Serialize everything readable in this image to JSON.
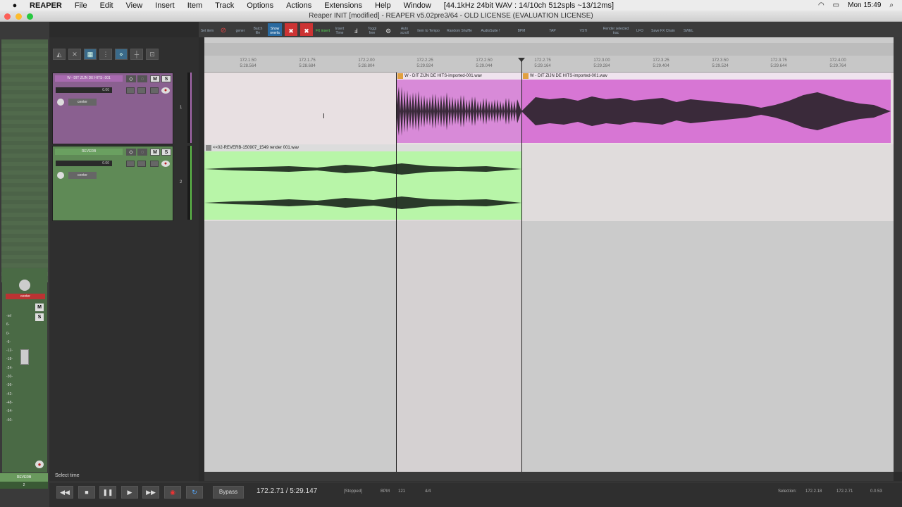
{
  "menubar": {
    "app": "REAPER",
    "items": [
      "File",
      "Edit",
      "View",
      "Insert",
      "Item",
      "Track",
      "Options",
      "Actions",
      "Extensions",
      "Help",
      "Window"
    ],
    "audio_info": "[44.1kHz 24bit WAV : 14/10ch 512spls ~13/12ms]",
    "clock": "Mon 15:49"
  },
  "window": {
    "title": "Reaper INIT [modified] - REAPER v5.02pre3/64 - OLD LICENSE (EVALUATION LICENSE)"
  },
  "toolbar": {
    "buttons": [
      "Set item",
      "",
      "gener",
      "Batch file",
      "Show overla",
      "",
      "",
      "FX insert",
      "Insert Time",
      "",
      "Toggl free",
      "",
      "Auto scroll",
      "Item to Tempo",
      "Random Shuffle",
      "AudioSuite !",
      "BPM",
      "TAP",
      "VSTi",
      "Render selected trac",
      "LFO",
      "Save FX Chain",
      "SWEL"
    ]
  },
  "tracks": [
    {
      "name": "W - DIT ZIJN DE HITS-.001",
      "vol": "0.00",
      "pan": "center",
      "num": "1",
      "color": "#a86ab0"
    },
    {
      "name": "REVERB",
      "vol": "0.00",
      "pan": "center",
      "num": "2",
      "color": "#6a9a5e"
    }
  ],
  "track_buttons": {
    "m": "M",
    "s": "S"
  },
  "ruler": {
    "ticks": [
      {
        "bar": "172.1.50",
        "time": "5:28.564"
      },
      {
        "bar": "172.1.75",
        "time": "5:28.684"
      },
      {
        "bar": "172.2.00",
        "time": "5:28.804"
      },
      {
        "bar": "172.2.25",
        "time": "5:29.924"
      },
      {
        "bar": "172.2.50",
        "time": "5:29.044"
      },
      {
        "bar": "172.2.75",
        "time": "5:29.164"
      },
      {
        "bar": "172.3.00",
        "time": "5:29.284"
      },
      {
        "bar": "172.3.25",
        "time": "5:29.404"
      },
      {
        "bar": "172.3.50",
        "time": "5:29.524"
      },
      {
        "bar": "172.3.75",
        "time": "5:29.644"
      },
      {
        "bar": "172.4.00",
        "time": "5:29.764"
      }
    ]
  },
  "items": {
    "item1a": "W - DIT ZIJN DE HITS-imported-001.wav",
    "item1b": "W - DIT ZIJN DE HITS-imported-001.wav",
    "item2": "<<02-REVERB-150907_1549 render 001.wav"
  },
  "mixer_strip": {
    "pan": "center",
    "db_labels": [
      "-inf",
      "6-",
      "0-",
      "-6-",
      "-12-",
      "-18-",
      "-24-",
      "-30-",
      "-36-",
      "-42-",
      "-48-",
      "-54-",
      "-60-"
    ],
    "name": "REVERB",
    "num": "2"
  },
  "transport": {
    "status_hint": "Select time",
    "bypass": "Bypass",
    "position": "172.2.71 / 5:29.147",
    "state": "[Stopped]",
    "bpm_label": "BPM",
    "bpm": "121",
    "timesig": "4/4",
    "selection_label": "Selection:",
    "sel_start": "172.2.18",
    "sel_end": "172.2.71",
    "sel_len": "0.0.53"
  }
}
